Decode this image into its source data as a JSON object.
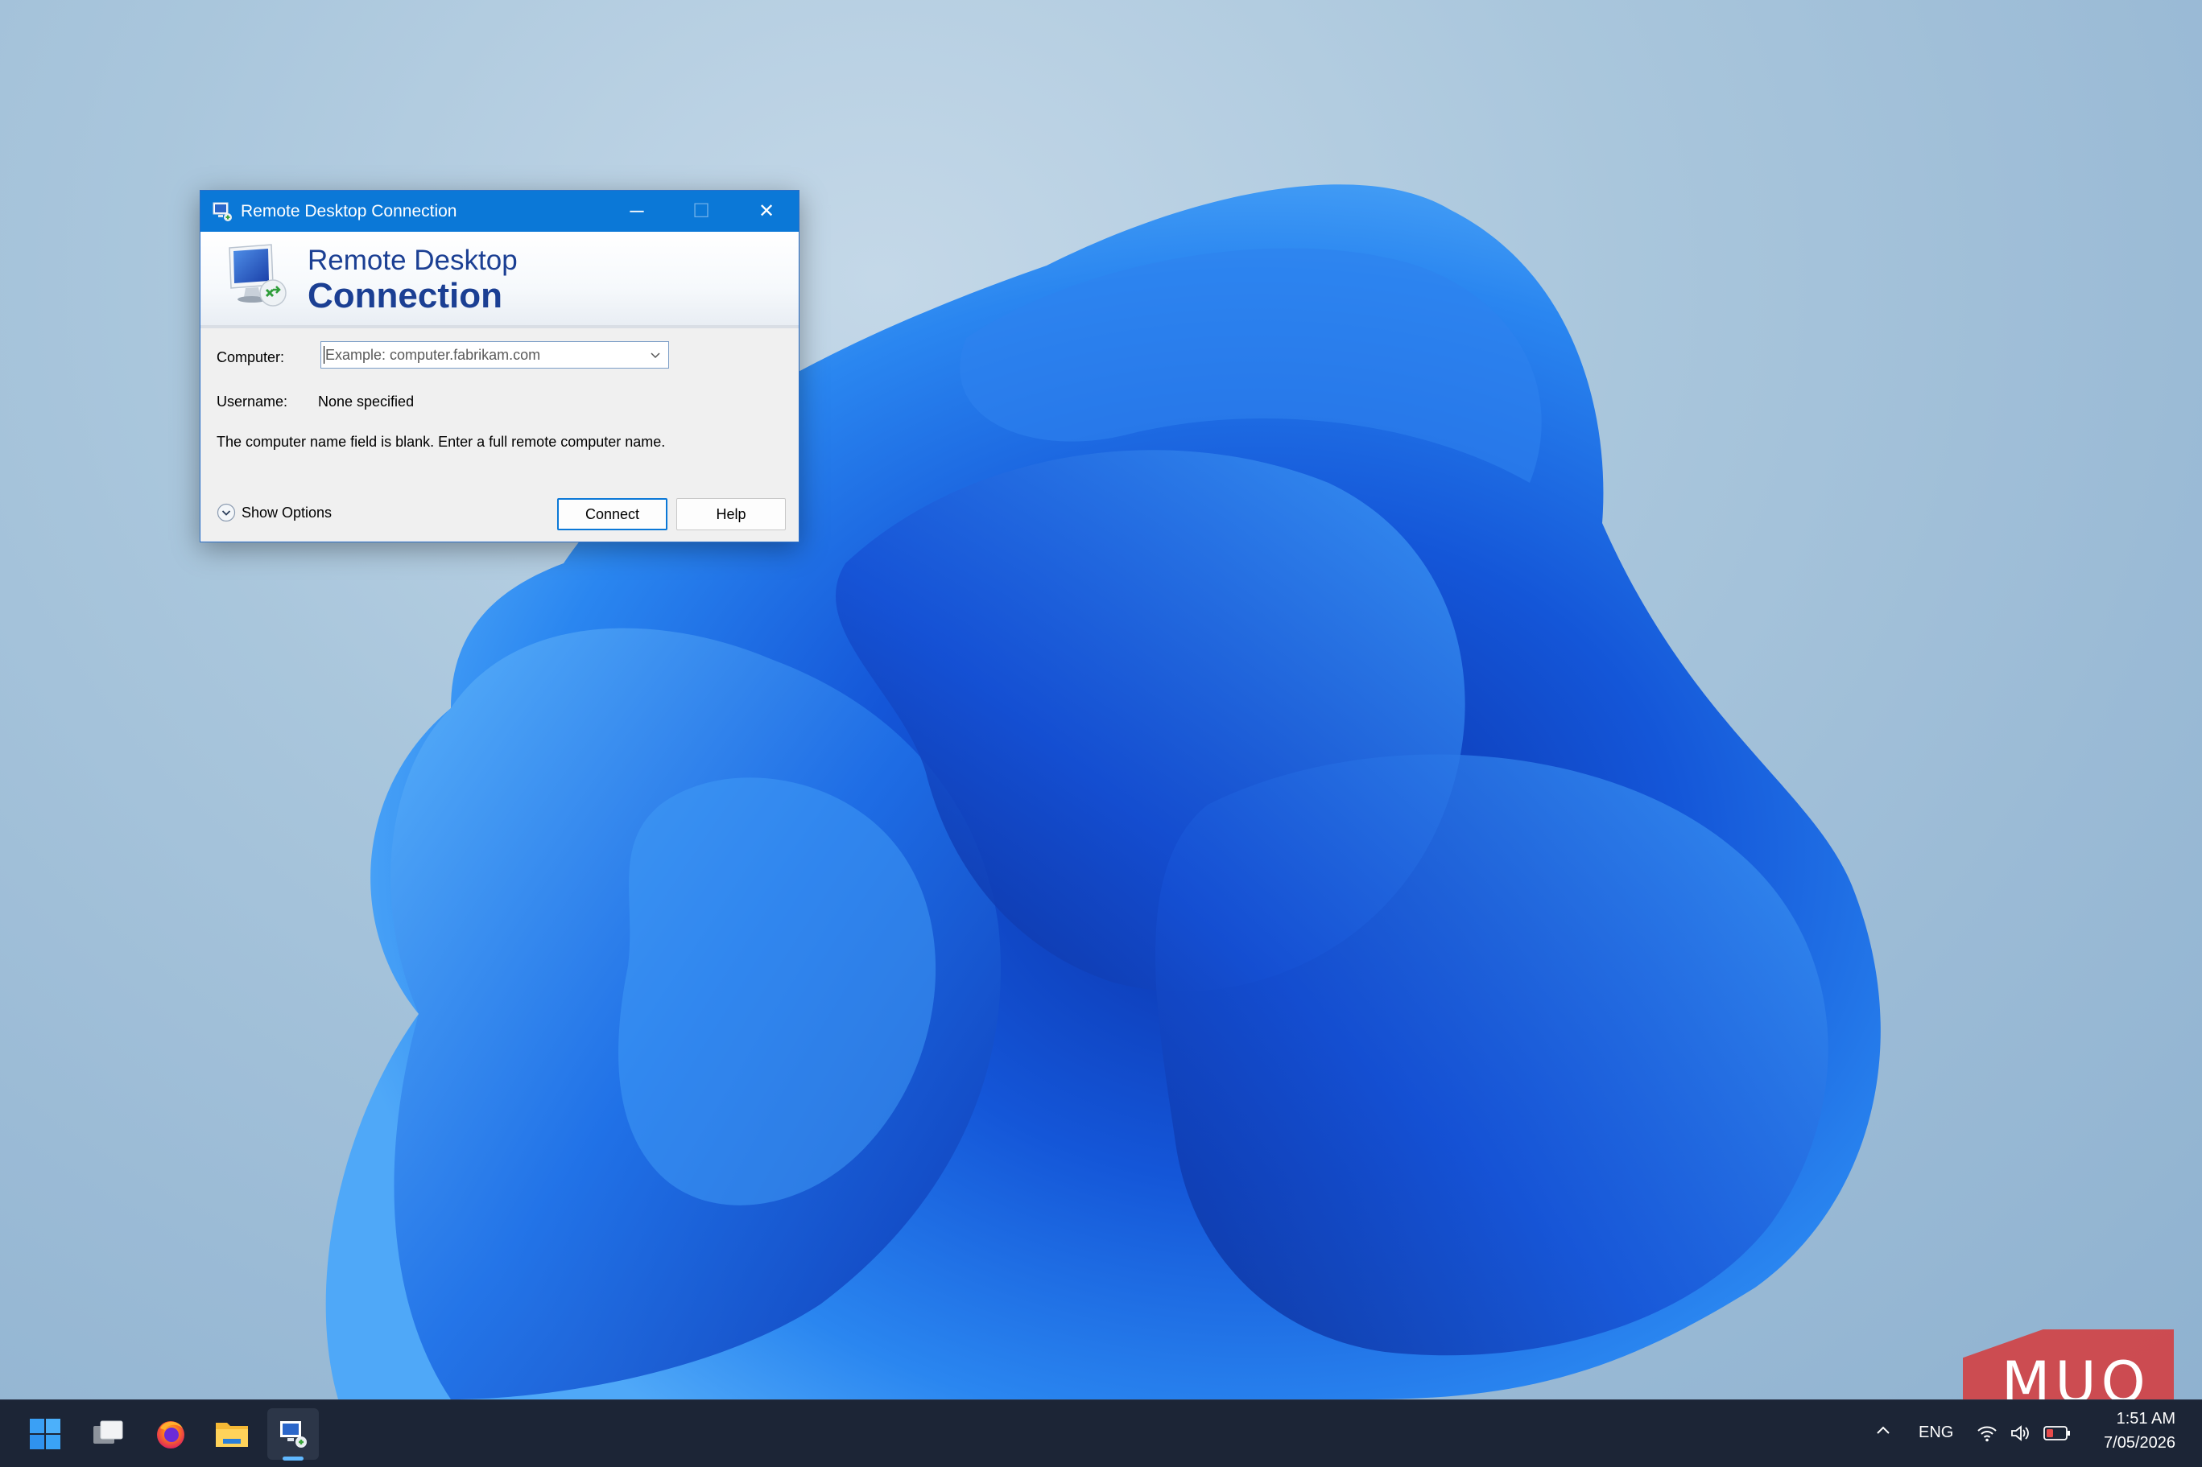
{
  "window": {
    "title": "Remote Desktop Connection",
    "minimize_glyph": "─",
    "maximize_glyph": "☐",
    "close_glyph": "✕",
    "accent": "#0b78d7"
  },
  "banner": {
    "line1": "Remote Desktop",
    "line2": "Connection",
    "text_color": "#1b3f93"
  },
  "form": {
    "computer_label": "Computer:",
    "computer_placeholder": "Example: computer.fabrikam.com",
    "computer_value": "",
    "username_label": "Username:",
    "username_value": "None specified",
    "info_text": "The computer name field is blank. Enter a full remote computer name."
  },
  "footer": {
    "show_options_label": "Show Options",
    "connect_label": "Connect",
    "help_label": "Help"
  },
  "taskbar": {
    "apps": [
      "start-icon",
      "task-view-icon",
      "firefox-icon",
      "file-explorer-icon",
      "remote-desktop-icon"
    ],
    "language": "ENG",
    "time": "1:51 AM",
    "date": "7/05/2026"
  },
  "watermark": {
    "text": "MUO"
  }
}
